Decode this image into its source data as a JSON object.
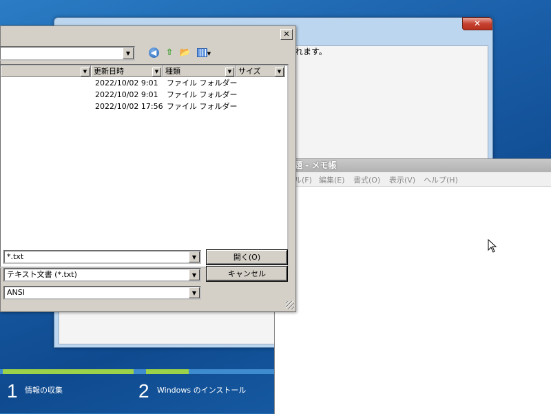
{
  "setup_window": {
    "close_label": "✕",
    "message": "は数回再起動されます。"
  },
  "progress": {
    "steps": [
      {
        "number": "1",
        "label": "情報の収集"
      },
      {
        "number": "2",
        "label": "Windows のインストール"
      }
    ],
    "colors": {
      "done": "#9bd24a",
      "track": "#3f8bd0"
    }
  },
  "notepad": {
    "title": "題 - メモ帳",
    "menu": [
      "ル(F)",
      "編集(E)",
      "書式(O)",
      "表示(V)",
      "ヘルプ(H)"
    ]
  },
  "open_dialog": {
    "close_label": "✕",
    "path_value": "",
    "toolbar_icons": [
      "back-icon",
      "up-folder-icon",
      "new-folder-icon",
      "view-menu-icon"
    ],
    "columns": [
      "",
      "更新日時",
      "種類",
      "サイズ"
    ],
    "rows": [
      {
        "modified": "2022/10/02 9:01",
        "type": "ファイル フォルダー",
        "size": ""
      },
      {
        "modified": "2022/10/02 9:01",
        "type": "ファイル フォルダー",
        "size": ""
      },
      {
        "modified": "2022/10/02 17:56",
        "type": "ファイル フォルダー",
        "size": ""
      }
    ],
    "filename_value": "*.txt",
    "filetype_value": "テキスト文書 (*.txt)",
    "encoding_value": "ANSI",
    "open_button": "開く(O)",
    "cancel_button": "キャンセル"
  }
}
